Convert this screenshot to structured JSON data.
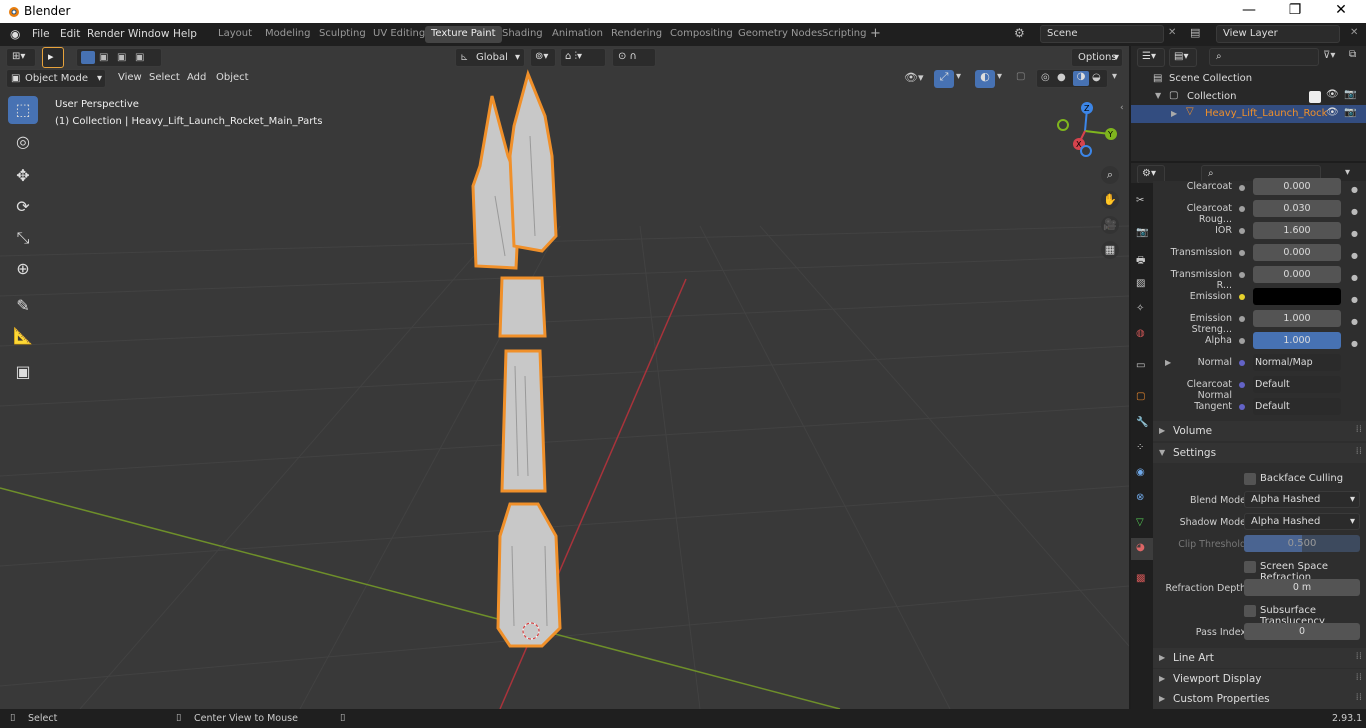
{
  "title_bar": {
    "app_title": "Blender",
    "minimize": "—",
    "maximize": "❐",
    "close": "✕"
  },
  "menu": [
    "File",
    "Edit",
    "Render",
    "Window",
    "Help"
  ],
  "workspaces": [
    "Layout",
    "Modeling",
    "Sculpting",
    "UV Editing",
    "Texture Paint",
    "Shading",
    "Animation",
    "Rendering",
    "Compositing",
    "Geometry Nodes",
    "Scripting"
  ],
  "active_workspace": "Texture Paint",
  "scene": "Scene",
  "view_layer": "View Layer",
  "viewport": {
    "transform_orientation": "Global",
    "options_label": "Options",
    "mode": "Object Mode",
    "header_menu": [
      "View",
      "Select",
      "Add",
      "Object"
    ],
    "perspective_label": "User Perspective",
    "collection_label": "(1) Collection | Heavy_Lift_Launch_Rocket_Main_Parts",
    "gizmo": {
      "x": "X",
      "y": "Y",
      "z": "Z"
    }
  },
  "outliner": {
    "scene_collection": "Scene Collection",
    "collection": "Collection",
    "object": "Heavy_Lift_Launch_Rock"
  },
  "properties": {
    "rows": [
      {
        "label": "Clearcoat",
        "value": "0.000"
      },
      {
        "label": "Clearcoat Roug...",
        "value": "0.030"
      },
      {
        "label": "IOR",
        "value": "1.600"
      },
      {
        "label": "Transmission",
        "value": "0.000"
      },
      {
        "label": "Transmission R...",
        "value": "0.000"
      },
      {
        "label": "Emission",
        "value": ""
      },
      {
        "label": "Emission Streng...",
        "value": "1.000"
      },
      {
        "label": "Alpha",
        "value": "1.000"
      },
      {
        "label": "Normal",
        "value": "Normal/Map"
      },
      {
        "label": "Clearcoat Normal",
        "value": "Default"
      },
      {
        "label": "Tangent",
        "value": "Default"
      }
    ],
    "panels": {
      "volume": "Volume",
      "settings": "Settings",
      "line_art": "Line Art",
      "viewport_display": "Viewport Display",
      "custom_properties": "Custom Properties"
    },
    "settings": {
      "backface_culling": "Backface Culling",
      "blend_mode_label": "Blend Mode",
      "blend_mode": "Alpha Hashed",
      "shadow_mode_label": "Shadow Mode",
      "shadow_mode": "Alpha Hashed",
      "clip_threshold_label": "Clip Threshold",
      "clip_threshold": "0.500",
      "screen_space_refraction": "Screen Space Refraction",
      "refraction_depth_label": "Refraction Depth",
      "refraction_depth": "0 m",
      "subsurface_translucency": "Subsurface Translucency",
      "pass_index_label": "Pass Index",
      "pass_index": "0"
    }
  },
  "status_bar": {
    "select": "Select",
    "center_view": "Center View to Mouse",
    "version": "2.93.1"
  },
  "colors": {
    "accent": "#4772b3",
    "selection_outline": "#f0902a",
    "x_axis": "#d6434d",
    "y_axis": "#7fb51e",
    "z_axis": "#3c86e8"
  }
}
